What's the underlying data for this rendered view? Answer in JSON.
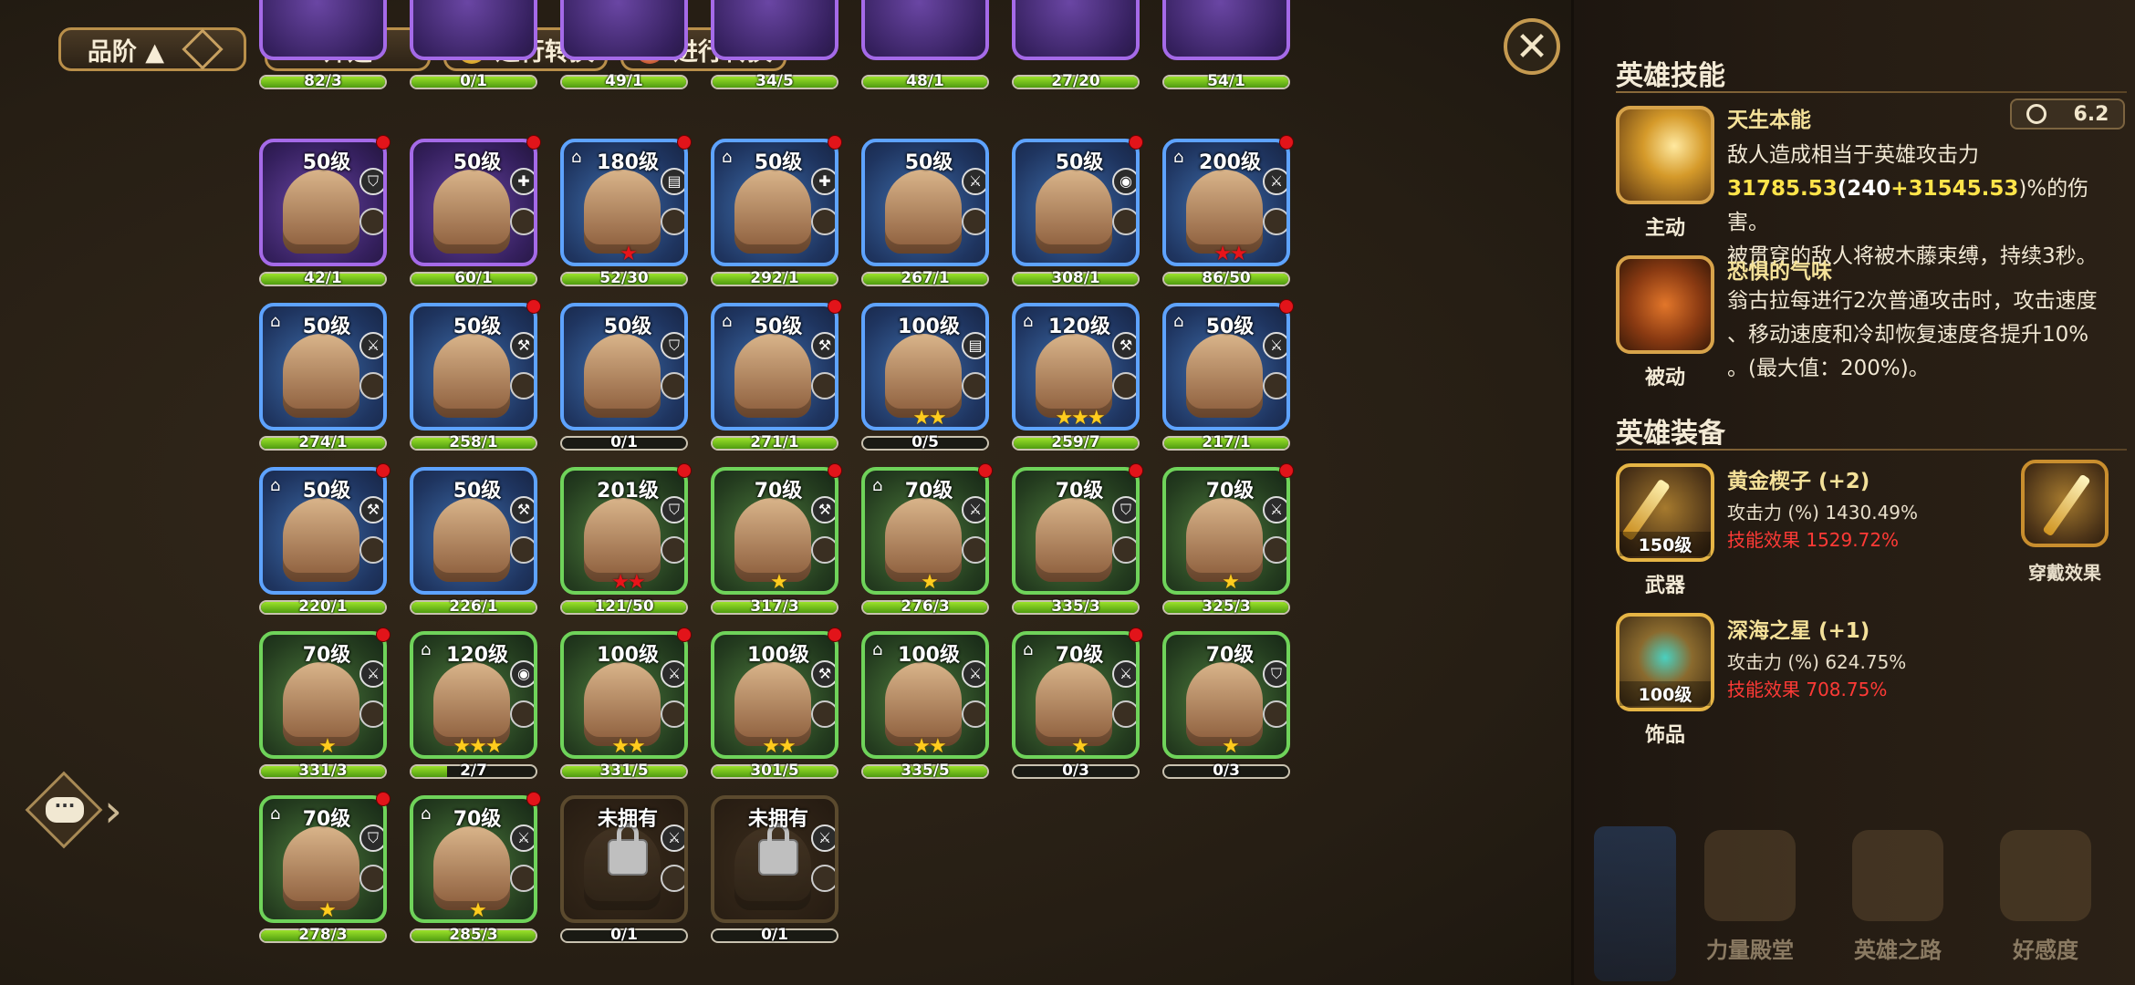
{
  "toolbar": {
    "sort_label": "品阶 ▲",
    "filter_label": "筛选",
    "convert1_label": "进行转换",
    "convert2_label": "进行转换"
  },
  "partial_row": [
    "82/3",
    "0/1",
    "49/1",
    "34/5",
    "48/1",
    "27/20",
    "54/1"
  ],
  "rows": [
    [
      {
        "lvl": "50级",
        "frame": "purple",
        "dot": true,
        "hanger": false,
        "role": "shield",
        "stars": "",
        "progress": "42/1",
        "fill": 1.0
      },
      {
        "lvl": "50级",
        "frame": "purple",
        "dot": true,
        "hanger": false,
        "role": "cross",
        "stars": "",
        "progress": "60/1",
        "fill": 1.0
      },
      {
        "lvl": "180级",
        "frame": "blue",
        "dot": true,
        "hanger": true,
        "role": "book",
        "stars": "R1",
        "progress": "52/30",
        "fill": 1.0
      },
      {
        "lvl": "50级",
        "frame": "blue",
        "dot": true,
        "hanger": true,
        "role": "cross",
        "stars": "",
        "progress": "292/1",
        "fill": 1.0
      },
      {
        "lvl": "50级",
        "frame": "blue",
        "dot": false,
        "hanger": false,
        "role": "sword",
        "stars": "",
        "progress": "267/1",
        "fill": 1.0
      },
      {
        "lvl": "50级",
        "frame": "blue",
        "dot": true,
        "hanger": false,
        "role": "helm",
        "stars": "",
        "progress": "308/1",
        "fill": 1.0
      },
      {
        "lvl": "200级",
        "frame": "blue",
        "dot": true,
        "hanger": true,
        "role": "sword",
        "stars": "R2",
        "progress": "86/50",
        "fill": 1.0
      }
    ],
    [
      {
        "lvl": "50级",
        "frame": "blue",
        "dot": false,
        "hanger": true,
        "role": "sword",
        "stars": "",
        "progress": "274/1",
        "fill": 1.0
      },
      {
        "lvl": "50级",
        "frame": "blue",
        "dot": true,
        "hanger": false,
        "role": "axe",
        "stars": "",
        "progress": "258/1",
        "fill": 1.0
      },
      {
        "lvl": "50级",
        "frame": "blue",
        "dot": false,
        "hanger": false,
        "role": "shield",
        "stars": "",
        "progress": "0/1",
        "fill": 0.0
      },
      {
        "lvl": "50级",
        "frame": "blue",
        "dot": true,
        "hanger": true,
        "role": "axe",
        "stars": "",
        "progress": "271/1",
        "fill": 1.0
      },
      {
        "lvl": "100级",
        "frame": "blue",
        "dot": false,
        "hanger": false,
        "role": "book",
        "stars": "G2",
        "progress": "0/5",
        "fill": 0.0
      },
      {
        "lvl": "120级",
        "frame": "blue",
        "dot": false,
        "hanger": true,
        "role": "axe",
        "stars": "G3",
        "progress": "259/7",
        "fill": 1.0
      },
      {
        "lvl": "50级",
        "frame": "blue",
        "dot": true,
        "hanger": true,
        "role": "sword",
        "stars": "",
        "progress": "217/1",
        "fill": 1.0
      }
    ],
    [
      {
        "lvl": "50级",
        "frame": "blue",
        "dot": true,
        "hanger": true,
        "role": "axe",
        "stars": "",
        "progress": "220/1",
        "fill": 1.0
      },
      {
        "lvl": "50级",
        "frame": "blue",
        "dot": false,
        "hanger": false,
        "role": "axe",
        "stars": "",
        "progress": "226/1",
        "fill": 1.0
      },
      {
        "lvl": "201级",
        "frame": "green",
        "dot": true,
        "hanger": false,
        "role": "shield",
        "stars": "R2",
        "progress": "121/50",
        "fill": 1.0
      },
      {
        "lvl": "70级",
        "frame": "green",
        "dot": true,
        "hanger": false,
        "role": "axe",
        "stars": "G1",
        "progress": "317/3",
        "fill": 1.0
      },
      {
        "lvl": "70级",
        "frame": "green",
        "dot": true,
        "hanger": true,
        "role": "sword",
        "stars": "G1",
        "progress": "276/3",
        "fill": 1.0
      },
      {
        "lvl": "70级",
        "frame": "green",
        "dot": true,
        "hanger": false,
        "role": "shield",
        "stars": "",
        "progress": "335/3",
        "fill": 1.0
      },
      {
        "lvl": "70级",
        "frame": "green",
        "dot": true,
        "hanger": false,
        "role": "sword",
        "stars": "G1",
        "progress": "325/3",
        "fill": 1.0
      }
    ],
    [
      {
        "lvl": "70级",
        "frame": "green",
        "dot": true,
        "hanger": false,
        "role": "sword",
        "stars": "G1",
        "progress": "331/3",
        "fill": 1.0
      },
      {
        "lvl": "120级",
        "frame": "green",
        "dot": false,
        "hanger": true,
        "role": "helm",
        "stars": "G3",
        "progress": "2/7",
        "fill": 0.29
      },
      {
        "lvl": "100级",
        "frame": "green",
        "dot": true,
        "hanger": false,
        "role": "sword",
        "stars": "G2",
        "progress": "331/5",
        "fill": 1.0
      },
      {
        "lvl": "100级",
        "frame": "green",
        "dot": true,
        "hanger": false,
        "role": "axe",
        "stars": "G2",
        "progress": "301/5",
        "fill": 1.0
      },
      {
        "lvl": "100级",
        "frame": "green",
        "dot": false,
        "hanger": true,
        "role": "sword",
        "stars": "G2",
        "progress": "335/5",
        "fill": 1.0
      },
      {
        "lvl": "70级",
        "frame": "green",
        "dot": true,
        "hanger": true,
        "role": "sword",
        "stars": "G1",
        "progress": "0/3",
        "fill": 0.0
      },
      {
        "lvl": "70级",
        "frame": "green",
        "dot": false,
        "hanger": false,
        "role": "shield",
        "stars": "G1",
        "progress": "0/3",
        "fill": 0.0
      }
    ],
    [
      {
        "lvl": "70级",
        "frame": "green",
        "dot": true,
        "hanger": true,
        "role": "shield",
        "stars": "G1",
        "progress": "278/3",
        "fill": 1.0
      },
      {
        "lvl": "70级",
        "frame": "green",
        "dot": true,
        "hanger": true,
        "role": "sword",
        "stars": "G1",
        "progress": "285/3",
        "fill": 1.0
      },
      {
        "lvl": "未拥有",
        "frame": "locked",
        "dot": false,
        "hanger": false,
        "role": "sword",
        "stars": "",
        "progress": "0/1",
        "fill": 0.0
      },
      {
        "lvl": "未拥有",
        "frame": "locked",
        "dot": false,
        "hanger": false,
        "role": "sword",
        "stars": "",
        "progress": "0/1",
        "fill": 0.0
      }
    ]
  ],
  "skills": {
    "title": "英雄技能",
    "active": {
      "label": "主动",
      "name": "天生本能",
      "cooldown": "6.2",
      "desc_line1": "敌人造成相当于英雄攻击力",
      "value_total": "31785.53",
      "paren_open": "(",
      "value_base": "240",
      "plus": "+",
      "value_bonus": "31545.53",
      "desc_tail": ")%的伤害。",
      "desc_line3": "被贯穿的敌人将被木藤束缚，持续3秒。"
    },
    "passive": {
      "label": "被动",
      "name": "恐惧的气味",
      "desc_line1": "翁古拉每进行2次普通攻击时，攻击速度",
      "desc_line2": "、移动速度和冷却恢复速度各提升10%",
      "desc_line3": "。(最大值：200%)。"
    }
  },
  "equipment": {
    "title": "英雄装备",
    "weapon": {
      "label": "武器",
      "level": "150级",
      "name": "黄金楔子 (+2)",
      "stat": "攻击力 (%) 1430.49%",
      "effect": "技能效果 1529.72%"
    },
    "accessory": {
      "label": "饰品",
      "level": "100级",
      "name": "深海之星 (+1)",
      "stat": "攻击力 (%) 624.75%",
      "effect": "技能效果 708.75%"
    },
    "wear_effect_label": "穿戴效果"
  },
  "bottom_nav": [
    "力量殿堂",
    "英雄之路",
    "好感度"
  ],
  "colors": {
    "gold_star": "#ffcc1e",
    "red_star": "#e8141a",
    "accent_yellow": "#ffe44a",
    "effect_red": "#ff3a36"
  }
}
